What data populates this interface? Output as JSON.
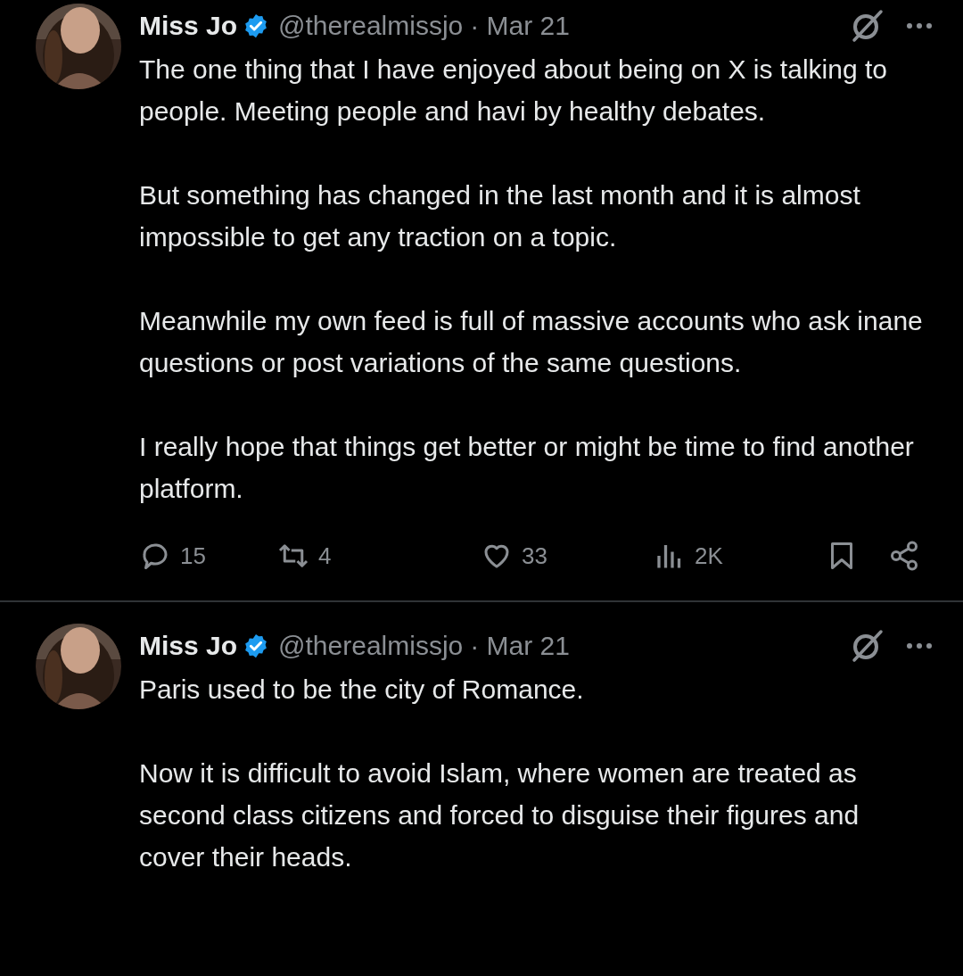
{
  "posts": [
    {
      "author": "Miss Jo",
      "verified": true,
      "handle": "@therealmissjo",
      "time": "· Mar 21",
      "paragraphs": [
        "The one thing that I have enjoyed about being on X is talking to people. Meeting people and havi by healthy debates.",
        "But something has changed in the last month and it is almost impossible to get any traction on a topic.",
        "Meanwhile my own feed is full of massive accounts who ask inane questions or post variations of the same questions.",
        "I really hope that things get better or might be time to find another platform."
      ],
      "actions": [
        {
          "kind": "reply",
          "count": "15"
        },
        {
          "kind": "repost",
          "count": "4"
        },
        {
          "kind": "like",
          "count": "33"
        },
        {
          "kind": "views",
          "count": "2K"
        },
        {
          "kind": "bookmark"
        },
        {
          "kind": "share"
        }
      ]
    },
    {
      "author": "Miss Jo",
      "verified": true,
      "handle": "@therealmissjo",
      "time": "· Mar 21",
      "paragraphs": [
        "Paris used to be the city of Romance.",
        "Now it is difficult to avoid Islam, where women are treated as second class citizens and forced to disguise their figures and cover their heads."
      ]
    }
  ]
}
